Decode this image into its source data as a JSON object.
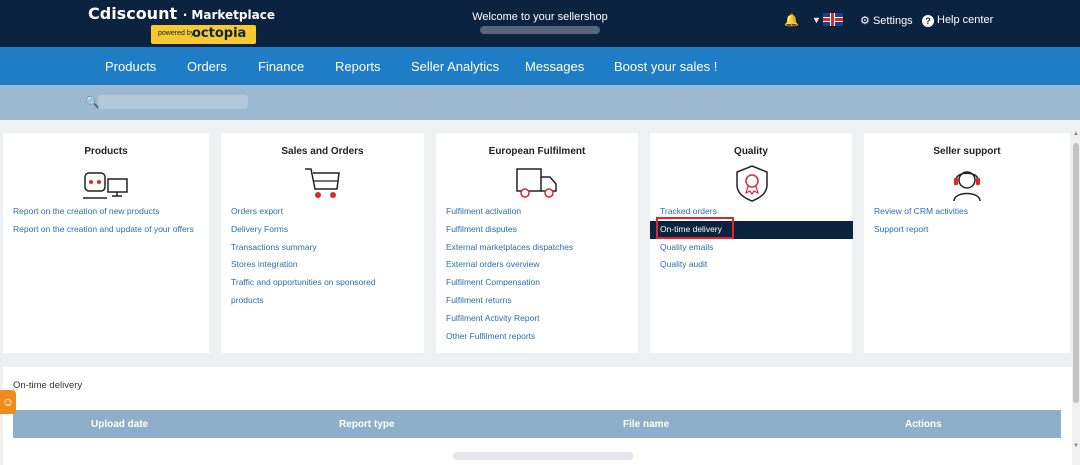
{
  "header": {
    "brand": "Cdiscount",
    "brand_suffix": "· Marketplace",
    "powered_by": "powered by",
    "octopia": "octopia",
    "welcome": "Welcome to your sellershop",
    "settings_label": "Settings",
    "help_label": "Help center"
  },
  "nav": {
    "items": [
      "Products",
      "Orders",
      "Finance",
      "Reports",
      "Seller Analytics",
      "Messages",
      "Boost your sales !"
    ]
  },
  "cards": [
    {
      "title": "Products",
      "links": [
        "Report on the creation of new products",
        "Report on the creation and update of your offers"
      ]
    },
    {
      "title": "Sales and Orders",
      "links": [
        "Orders export",
        "Delivery Forms",
        "Transactions summary",
        "Stores integration",
        "Traffic and opportunities on sponsored products"
      ]
    },
    {
      "title": "European Fulfilment",
      "links": [
        "Fulfilment activation",
        "Fulfilment disputes",
        "External marketplaces dispatches",
        "External orders overview",
        "Fulfilment Compensation",
        "Fulfilment returns",
        "Fulfilment Activity Report",
        "Other Fulfilment reports"
      ]
    },
    {
      "title": "Quality",
      "links": [
        "Tracked orders",
        "On-time delivery",
        "Quality emails",
        "Quality audit"
      ]
    },
    {
      "title": "Seller support",
      "links": [
        "Review of CRM activities",
        "Support report"
      ]
    }
  ],
  "section": {
    "title": "On-time delivery",
    "columns": [
      "Upload date",
      "Report type",
      "File name",
      "Actions"
    ]
  },
  "colors": {
    "header_bg": "#0c2340",
    "nav_bg": "#1f7dc6",
    "accent_yellow": "#f7c92f",
    "link": "#2b6ea8",
    "active_bg": "#0c2340",
    "highlight": "#e0262c",
    "table_head": "#8faec8"
  }
}
